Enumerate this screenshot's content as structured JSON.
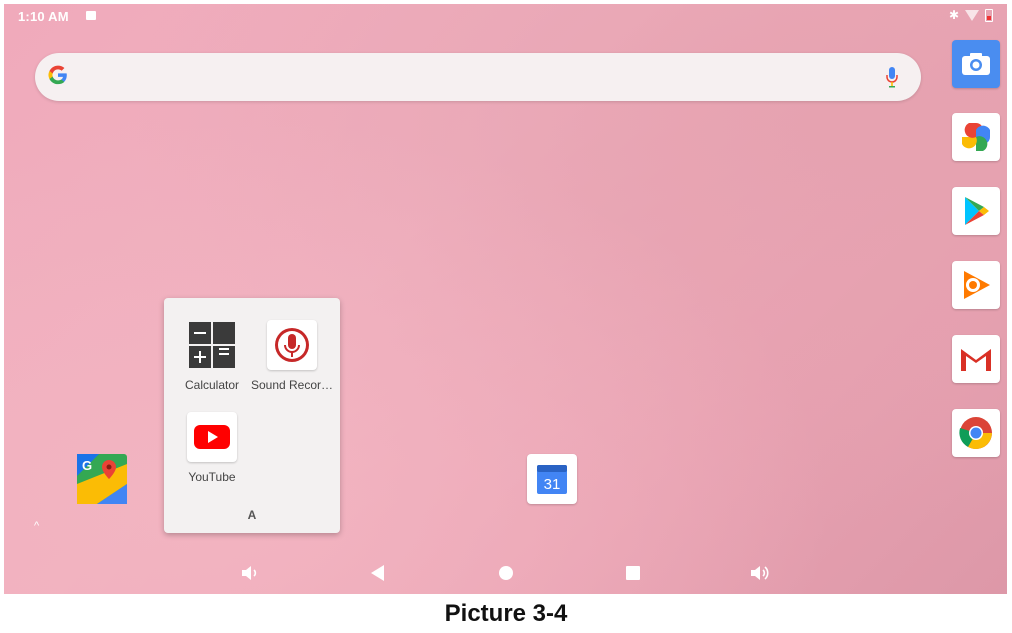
{
  "status_bar": {
    "time": "1:10 AM"
  },
  "search": {
    "placeholder": ""
  },
  "folder": {
    "name": "A",
    "apps": [
      {
        "label": "Calculator"
      },
      {
        "label": "Sound Recor…"
      },
      {
        "label": "YouTube"
      }
    ]
  },
  "home": {
    "apps": [
      {
        "label": "Maps"
      },
      {
        "label": "Calendar",
        "date": "31"
      }
    ]
  },
  "dock": [
    "camera-icon",
    "photos-icon",
    "play-store-icon",
    "play-music-icon",
    "gmail-icon",
    "chrome-icon"
  ],
  "caption": "Picture 3-4",
  "colors": {
    "wallpaper": "#eea9b9",
    "accent_blue": "#4285F4",
    "youtube_red": "#FF0000"
  }
}
